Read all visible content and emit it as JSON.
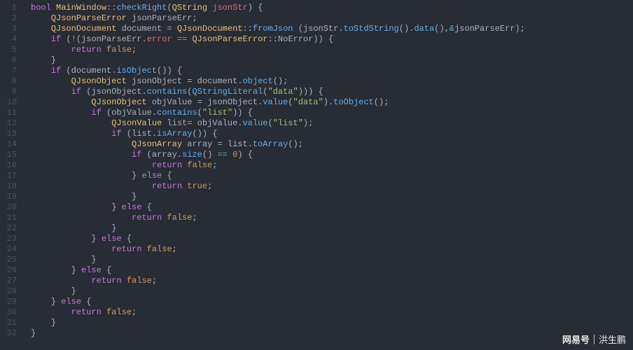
{
  "editor": {
    "line_count": 32,
    "lines": [
      [
        {
          "t": "bool",
          "c": "type"
        },
        {
          "t": " "
        },
        {
          "t": "MainWindow",
          "c": "class"
        },
        {
          "t": "::",
          "c": "punct"
        },
        {
          "t": "checkRight",
          "c": "func"
        },
        {
          "t": "(",
          "c": "punct"
        },
        {
          "t": "QString",
          "c": "class"
        },
        {
          "t": " "
        },
        {
          "t": "jsonStr",
          "c": "param"
        },
        {
          "t": ") {",
          "c": "punct"
        }
      ],
      [
        {
          "t": "    "
        },
        {
          "t": "QJsonParseError",
          "c": "class"
        },
        {
          "t": " "
        },
        {
          "t": "jsonParseErr",
          "c": "ident"
        },
        {
          "t": ";",
          "c": "punct"
        }
      ],
      [
        {
          "t": "    "
        },
        {
          "t": "QJsonDocument",
          "c": "class"
        },
        {
          "t": " "
        },
        {
          "t": "document",
          "c": "ident"
        },
        {
          "t": " = ",
          "c": "punct"
        },
        {
          "t": "QJsonDocument",
          "c": "class"
        },
        {
          "t": "::",
          "c": "punct"
        },
        {
          "t": "fromJson",
          "c": "func"
        },
        {
          "t": " (",
          "c": "punct"
        },
        {
          "t": "jsonStr",
          "c": "ident"
        },
        {
          "t": ".",
          "c": "punct"
        },
        {
          "t": "toStdString",
          "c": "func"
        },
        {
          "t": "().",
          "c": "punct"
        },
        {
          "t": "data",
          "c": "func"
        },
        {
          "t": "(),",
          "c": "punct"
        },
        {
          "t": "&",
          "c": "op"
        },
        {
          "t": "jsonParseErr",
          "c": "ident"
        },
        {
          "t": ");",
          "c": "punct"
        }
      ],
      [
        {
          "t": "    "
        },
        {
          "t": "if",
          "c": "keyword"
        },
        {
          "t": " (",
          "c": "punct"
        },
        {
          "t": "!",
          "c": "op"
        },
        {
          "t": "(",
          "c": "punct"
        },
        {
          "t": "jsonParseErr",
          "c": "ident"
        },
        {
          "t": ".",
          "c": "punct"
        },
        {
          "t": "error",
          "c": "prop"
        },
        {
          "t": " ",
          "c": "punct"
        },
        {
          "t": "==",
          "c": "op"
        },
        {
          "t": " ",
          "c": "punct"
        },
        {
          "t": "QJsonParseError",
          "c": "class"
        },
        {
          "t": "::",
          "c": "punct"
        },
        {
          "t": "NoError",
          "c": "ident"
        },
        {
          "t": ")) {",
          "c": "punct"
        }
      ],
      [
        {
          "t": "        "
        },
        {
          "t": "return",
          "c": "keyword"
        },
        {
          "t": " "
        },
        {
          "t": "false",
          "c": "literal"
        },
        {
          "t": ";",
          "c": "punct"
        }
      ],
      [
        {
          "t": "    }",
          "c": "punct"
        }
      ],
      [
        {
          "t": "    "
        },
        {
          "t": "if",
          "c": "keyword"
        },
        {
          "t": " (",
          "c": "punct"
        },
        {
          "t": "document",
          "c": "ident"
        },
        {
          "t": ".",
          "c": "punct"
        },
        {
          "t": "isObject",
          "c": "func"
        },
        {
          "t": "()) {",
          "c": "punct"
        }
      ],
      [
        {
          "t": "        "
        },
        {
          "t": "QJsonObject",
          "c": "class"
        },
        {
          "t": " "
        },
        {
          "t": "jsonObject",
          "c": "ident"
        },
        {
          "t": " = ",
          "c": "punct"
        },
        {
          "t": "document",
          "c": "ident"
        },
        {
          "t": ".",
          "c": "punct"
        },
        {
          "t": "object",
          "c": "func"
        },
        {
          "t": "();",
          "c": "punct"
        }
      ],
      [
        {
          "t": "        "
        },
        {
          "t": "if",
          "c": "keyword"
        },
        {
          "t": " (",
          "c": "punct"
        },
        {
          "t": "jsonObject",
          "c": "ident"
        },
        {
          "t": ".",
          "c": "punct"
        },
        {
          "t": "contains",
          "c": "func"
        },
        {
          "t": "(",
          "c": "punct"
        },
        {
          "t": "QStringLiteral",
          "c": "func"
        },
        {
          "t": "(",
          "c": "punct"
        },
        {
          "t": "\"data\"",
          "c": "string"
        },
        {
          "t": "))) {",
          "c": "punct"
        }
      ],
      [
        {
          "t": "            "
        },
        {
          "t": "QJsonObject",
          "c": "class"
        },
        {
          "t": " "
        },
        {
          "t": "objValue",
          "c": "ident"
        },
        {
          "t": " = ",
          "c": "punct"
        },
        {
          "t": "jsonObject",
          "c": "ident"
        },
        {
          "t": ".",
          "c": "punct"
        },
        {
          "t": "value",
          "c": "func"
        },
        {
          "t": "(",
          "c": "punct"
        },
        {
          "t": "\"data\"",
          "c": "string"
        },
        {
          "t": ").",
          "c": "punct"
        },
        {
          "t": "toObject",
          "c": "func"
        },
        {
          "t": "();",
          "c": "punct"
        }
      ],
      [
        {
          "t": "            "
        },
        {
          "t": "if",
          "c": "keyword"
        },
        {
          "t": " (",
          "c": "punct"
        },
        {
          "t": "objValue",
          "c": "ident"
        },
        {
          "t": ".",
          "c": "punct"
        },
        {
          "t": "contains",
          "c": "func"
        },
        {
          "t": "(",
          "c": "punct"
        },
        {
          "t": "\"list\"",
          "c": "string"
        },
        {
          "t": ")) {",
          "c": "punct"
        }
      ],
      [
        {
          "t": "                "
        },
        {
          "t": "QJsonValue",
          "c": "class"
        },
        {
          "t": " "
        },
        {
          "t": "list",
          "c": "ident"
        },
        {
          "t": "= ",
          "c": "punct"
        },
        {
          "t": "objValue",
          "c": "ident"
        },
        {
          "t": ".",
          "c": "punct"
        },
        {
          "t": "value",
          "c": "func"
        },
        {
          "t": "(",
          "c": "punct"
        },
        {
          "t": "\"list\"",
          "c": "string"
        },
        {
          "t": ");",
          "c": "punct"
        }
      ],
      [
        {
          "t": "                "
        },
        {
          "t": "if",
          "c": "keyword"
        },
        {
          "t": " (",
          "c": "punct"
        },
        {
          "t": "list",
          "c": "ident"
        },
        {
          "t": ".",
          "c": "punct"
        },
        {
          "t": "isArray",
          "c": "func"
        },
        {
          "t": "()) {",
          "c": "punct"
        }
      ],
      [
        {
          "t": "                    "
        },
        {
          "t": "QJsonArray",
          "c": "class"
        },
        {
          "t": " "
        },
        {
          "t": "array",
          "c": "ident"
        },
        {
          "t": " = ",
          "c": "punct"
        },
        {
          "t": "list",
          "c": "ident"
        },
        {
          "t": ".",
          "c": "punct"
        },
        {
          "t": "toArray",
          "c": "func"
        },
        {
          "t": "();",
          "c": "punct"
        }
      ],
      [
        {
          "t": "                    "
        },
        {
          "t": "if",
          "c": "keyword"
        },
        {
          "t": " (",
          "c": "punct"
        },
        {
          "t": "array",
          "c": "ident"
        },
        {
          "t": ".",
          "c": "punct"
        },
        {
          "t": "size",
          "c": "func"
        },
        {
          "t": "() ",
          "c": "punct"
        },
        {
          "t": "==",
          "c": "op"
        },
        {
          "t": " ",
          "c": "punct"
        },
        {
          "t": "0",
          "c": "number"
        },
        {
          "t": ") {",
          "c": "punct"
        }
      ],
      [
        {
          "t": "                        "
        },
        {
          "t": "return",
          "c": "keyword"
        },
        {
          "t": " "
        },
        {
          "t": "false",
          "c": "literal"
        },
        {
          "t": ";",
          "c": "punct"
        }
      ],
      [
        {
          "t": "                    } ",
          "c": "punct"
        },
        {
          "t": "else",
          "c": "keyword"
        },
        {
          "t": " {",
          "c": "punct"
        }
      ],
      [
        {
          "t": "                        "
        },
        {
          "t": "return",
          "c": "keyword"
        },
        {
          "t": " "
        },
        {
          "t": "true",
          "c": "literal"
        },
        {
          "t": ";",
          "c": "punct"
        }
      ],
      [
        {
          "t": "                    }",
          "c": "punct"
        }
      ],
      [
        {
          "t": "                } ",
          "c": "punct"
        },
        {
          "t": "else",
          "c": "keyword"
        },
        {
          "t": " {",
          "c": "punct"
        }
      ],
      [
        {
          "t": "                    "
        },
        {
          "t": "return",
          "c": "keyword"
        },
        {
          "t": " "
        },
        {
          "t": "false",
          "c": "literal"
        },
        {
          "t": ";",
          "c": "punct"
        }
      ],
      [
        {
          "t": "                }",
          "c": "punct"
        }
      ],
      [
        {
          "t": "            } ",
          "c": "punct"
        },
        {
          "t": "else",
          "c": "keyword"
        },
        {
          "t": " {",
          "c": "punct"
        }
      ],
      [
        {
          "t": "                "
        },
        {
          "t": "return",
          "c": "keyword"
        },
        {
          "t": " "
        },
        {
          "t": "false",
          "c": "literal"
        },
        {
          "t": ";",
          "c": "punct"
        }
      ],
      [
        {
          "t": "            }",
          "c": "punct"
        }
      ],
      [
        {
          "t": "        } ",
          "c": "punct"
        },
        {
          "t": "else",
          "c": "keyword"
        },
        {
          "t": " {",
          "c": "punct"
        }
      ],
      [
        {
          "t": "            "
        },
        {
          "t": "return",
          "c": "keyword"
        },
        {
          "t": " "
        },
        {
          "t": "false",
          "c": "literal"
        },
        {
          "t": ";",
          "c": "punct"
        }
      ],
      [
        {
          "t": "        }",
          "c": "punct"
        }
      ],
      [
        {
          "t": "    } ",
          "c": "punct"
        },
        {
          "t": "else",
          "c": "keyword"
        },
        {
          "t": " {",
          "c": "punct"
        }
      ],
      [
        {
          "t": "        "
        },
        {
          "t": "return",
          "c": "keyword"
        },
        {
          "t": " "
        },
        {
          "t": "false",
          "c": "literal"
        },
        {
          "t": ";",
          "c": "punct"
        }
      ],
      [
        {
          "t": "    }",
          "c": "punct"
        }
      ],
      [
        {
          "t": "}",
          "c": "punct"
        }
      ]
    ]
  },
  "watermark": {
    "brand": "网易号",
    "author": "洪生鹏"
  }
}
